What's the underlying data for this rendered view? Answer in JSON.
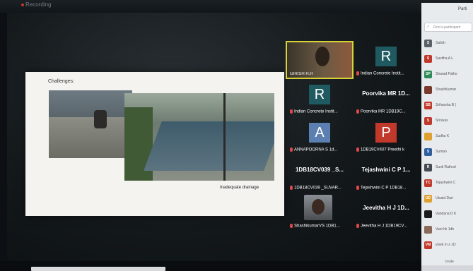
{
  "top": {
    "title": "Recording"
  },
  "slide": {
    "title": "Challenges:",
    "caption": "Inadequate drainage"
  },
  "tiles": [
    {
      "label": "GIRISH H.R",
      "type": "video"
    },
    {
      "initial": "R",
      "label": "Indian Concrete Instit...",
      "color": "#1f5a61"
    },
    {
      "initial": "R",
      "label": "Indian Concrete Instit...",
      "color": "#1f5a61"
    },
    {
      "big": "Poorvika MR 1D...",
      "label": "Poorvika MR 1DB19C..."
    },
    {
      "initial": "A",
      "label": "ANNAPOORNA S 1d...",
      "color": "#5b7fb0"
    },
    {
      "initial": "P",
      "label": "1DB19CV407 Preethi k",
      "color": "#c0392b"
    },
    {
      "big": "1DB18CV039 _S...",
      "label": "1DB18CV039 _SUVAR..."
    },
    {
      "big": "Tejashwini C P 1...",
      "label": "Tejashwini C P 1DB18..."
    },
    {
      "label": "ShashikumarVS 1DB1...",
      "type": "photo"
    },
    {
      "big": "Jeevitha H J 1D...",
      "label": "Jeevitha H J 1DB19CV..."
    }
  ],
  "panel": {
    "title": "Parti",
    "search_placeholder": "Find a participant",
    "participants": [
      {
        "initial": "S",
        "name": "Satish",
        "color": "#5b5f66"
      },
      {
        "initial": "S",
        "name": "Savitha A L",
        "color": "#c0392b"
      },
      {
        "initial": "SP",
        "name": "Sharad Patho",
        "color": "#2e8b57"
      },
      {
        "initial": "",
        "name": "Shashikumar",
        "color": "#7a3b2e"
      },
      {
        "initial": "SB",
        "name": "Sriharsha B (",
        "color": "#c0392b"
      },
      {
        "initial": "S",
        "name": "Srinivas",
        "color": "#c0392b"
      },
      {
        "initial": "",
        "name": "Sudha K",
        "color": "#e0a030"
      },
      {
        "initial": "S",
        "name": "Suman",
        "color": "#2f5f9e"
      },
      {
        "initial": "R",
        "name": "Sunil Rathod",
        "color": "#444b52"
      },
      {
        "initial": "TC",
        "name": "Tejashwini C",
        "color": "#c0392b"
      },
      {
        "initial": "UD",
        "name": "Utsaid Dari",
        "color": "#e0a030"
      },
      {
        "initial": "",
        "name": "Vandana D K",
        "color": "#1a1a1a"
      },
      {
        "initial": "",
        "name": "Vani hk 1db",
        "color": "#8a6a5a"
      },
      {
        "initial": "VM",
        "name": "vivek m s 1D",
        "color": "#c0392b"
      }
    ],
    "invite": "Invite"
  }
}
